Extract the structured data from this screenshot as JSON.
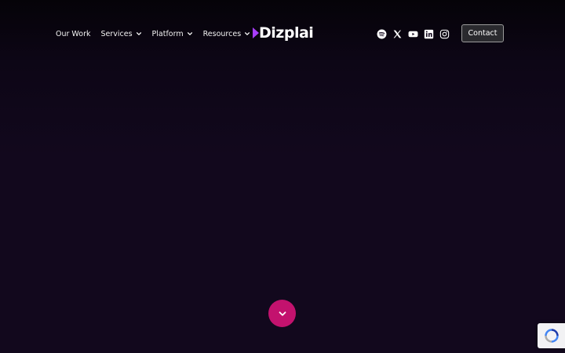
{
  "nav": {
    "items": [
      {
        "label": "Our Work",
        "has_dropdown": false
      },
      {
        "label": "Services",
        "has_dropdown": true
      },
      {
        "label": "Platform",
        "has_dropdown": true
      },
      {
        "label": "Resources",
        "has_dropdown": true
      }
    ]
  },
  "logo": {
    "text": "Dizplai",
    "accent_color": "#a83dff"
  },
  "socials": [
    "spotify-icon",
    "x-icon",
    "youtube-icon",
    "linkedin-icon",
    "instagram-icon"
  ],
  "header": {
    "contact_label": "Contact"
  },
  "scroll_button": {
    "icon": "chevron-down-icon",
    "color": "#c3126e"
  },
  "colors": {
    "background": "#12081d",
    "text": "#ffffff"
  }
}
